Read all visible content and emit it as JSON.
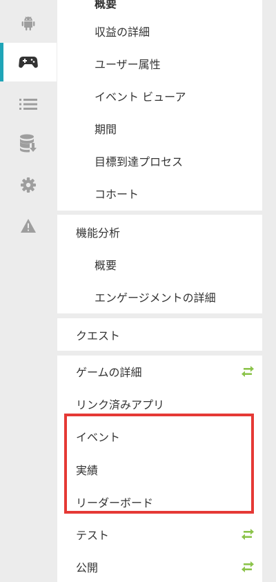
{
  "rail": {
    "items": [
      {
        "name": "android-icon"
      },
      {
        "name": "gamepad-icon",
        "active": true
      },
      {
        "name": "list-icon"
      },
      {
        "name": "database-icon"
      },
      {
        "name": "gear-icon"
      },
      {
        "name": "warning-icon"
      }
    ]
  },
  "menu": {
    "group1": {
      "partial_top_label": "概要",
      "items": [
        "収益の詳細",
        "ユーザー属性",
        "イベント ビューア",
        "期間",
        "目標到達プロセス",
        "コホート"
      ]
    },
    "group2": {
      "title": "機能分析",
      "items": [
        "概要",
        "エンゲージメントの詳細"
      ]
    },
    "group3": {
      "title": "クエスト"
    },
    "group4": {
      "items": [
        {
          "label": "ゲームの詳細",
          "sync": true
        },
        {
          "label": "リンク済みアプリ",
          "sync": false
        },
        {
          "label": "イベント",
          "sync": false
        },
        {
          "label": "実績",
          "sync": false
        },
        {
          "label": "リーダーボード",
          "sync": false
        },
        {
          "label": "テスト",
          "sync": true
        },
        {
          "label": "公開",
          "sync": true
        }
      ]
    }
  },
  "colors": {
    "accent": "#1fa5b8",
    "sync": "#8bc34a",
    "highlight": "#e53935"
  }
}
